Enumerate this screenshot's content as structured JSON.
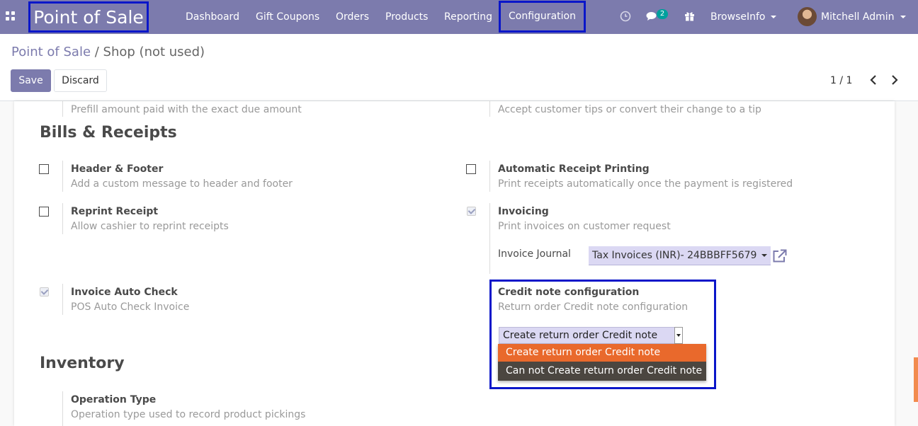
{
  "navbar": {
    "brand": "Point of Sale",
    "menu": [
      "Dashboard",
      "Gift Coupons",
      "Orders",
      "Products",
      "Reporting"
    ],
    "config_label": "Configuration",
    "messages_badge": "2",
    "company": "BrowseInfo",
    "user": "Mitchell Admin"
  },
  "breadcrumb": {
    "root": "Point of Sale",
    "separator": " / ",
    "current": "Shop (not used)"
  },
  "actions": {
    "save": "Save",
    "discard": "Discard"
  },
  "pager": {
    "value": "1 / 1"
  },
  "settings": {
    "prefill_desc": "Prefill amount paid with the exact due amount",
    "tips_desc": "Accept customer tips or convert their change to a tip",
    "bills_title": "Bills & Receipts",
    "header_footer": {
      "label": "Header & Footer",
      "desc": "Add a custom message to header and footer",
      "checked": false
    },
    "auto_print": {
      "label": "Automatic Receipt Printing",
      "desc": "Print receipts automatically once the payment is registered",
      "checked": false
    },
    "reprint": {
      "label": "Reprint Receipt",
      "desc": "Allow cashier to reprint receipts",
      "checked": false
    },
    "invoicing": {
      "label": "Invoicing",
      "desc": "Print invoices on customer request",
      "checked": true,
      "journal_label": "Invoice Journal",
      "journal_value": "Tax Invoices (INR)- 24BBBFF5679"
    },
    "auto_check": {
      "label": "Invoice Auto Check",
      "desc": "POS Auto Check Invoice",
      "checked": true
    },
    "credit_note": {
      "label": "Credit note configuration",
      "desc": "Return order Credit note configuration",
      "selected": "Create return order Credit note",
      "options": [
        "Create return order Credit note",
        "Can not Create return order Credit note"
      ]
    },
    "inventory_title": "Inventory",
    "operation_type": {
      "label": "Operation Type",
      "desc": "Operation type used to record product pickings"
    }
  },
  "colors": {
    "primary": "#7c7bad",
    "highlight_border": "#0a16c9",
    "dropdown_bg": "#4b4640",
    "dropdown_selected": "#e9692c",
    "badge": "#00a09d"
  },
  "icons": [
    "apps-grid-icon",
    "clock-icon",
    "chat-icon",
    "gift-icon",
    "chevron-left-icon",
    "chevron-right-icon",
    "external-link-icon"
  ]
}
